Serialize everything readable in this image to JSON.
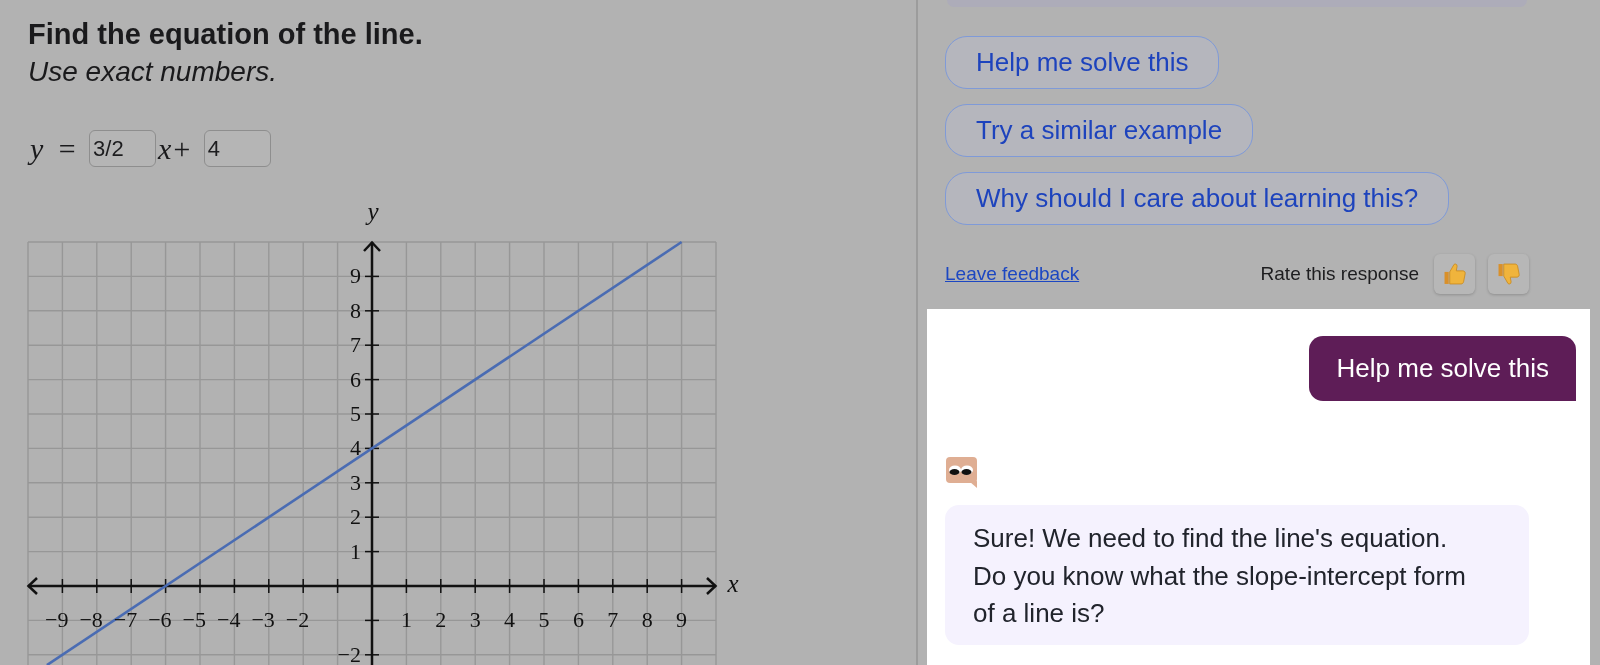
{
  "problem": {
    "title": "Find the equation of the line.",
    "instruction": "Use exact numbers.",
    "equation": [
      {
        "kind": "math",
        "text": "y ="
      },
      {
        "kind": "input",
        "value": "3/2"
      },
      {
        "kind": "math",
        "text": "x+"
      },
      {
        "kind": "input",
        "value": "4"
      }
    ],
    "graph": {
      "chart_data": {
        "type": "line",
        "grid": true,
        "xlabel": "x",
        "ylabel": "y",
        "x": [
          -9.45,
          9
        ],
        "series": [
          {
            "color": "#4a6cb3",
            "values": [
              -2.3,
              10
            ]
          }
        ],
        "xlim": [
          -10,
          10
        ],
        "ylim": [
          -2.3,
          10
        ],
        "xticks": [
          {
            "value": -9,
            "label": "−9"
          },
          {
            "value": -8,
            "label": "−8"
          },
          {
            "value": -7,
            "label": "−7"
          },
          {
            "value": -6,
            "label": "−6"
          },
          {
            "value": -5,
            "label": "−5"
          },
          {
            "value": -4,
            "label": "−4"
          },
          {
            "value": -3,
            "label": "−3"
          },
          {
            "value": -2,
            "label": "−2"
          },
          1,
          2,
          3,
          4,
          5,
          6,
          7,
          8,
          9
        ],
        "yticks": [
          {
            "value": -2,
            "label": "−2"
          },
          1,
          2,
          3,
          4,
          5,
          6,
          7,
          8,
          9
        ]
      }
    }
  },
  "tutor": {
    "suggestions": [
      {
        "label": "Help me solve this"
      },
      {
        "label": "Try a similar example"
      },
      {
        "label": "Why should I care about learning this?"
      }
    ],
    "feedback": {
      "link": "Leave feedback",
      "rate_label": "Rate this response"
    },
    "messages": [
      {
        "kind": "user",
        "text": "Help me solve this"
      },
      {
        "kind": "bot",
        "text": "Sure! We need to find the line's equation. Do you know what the slope-intercept form of a line is?"
      }
    ]
  }
}
